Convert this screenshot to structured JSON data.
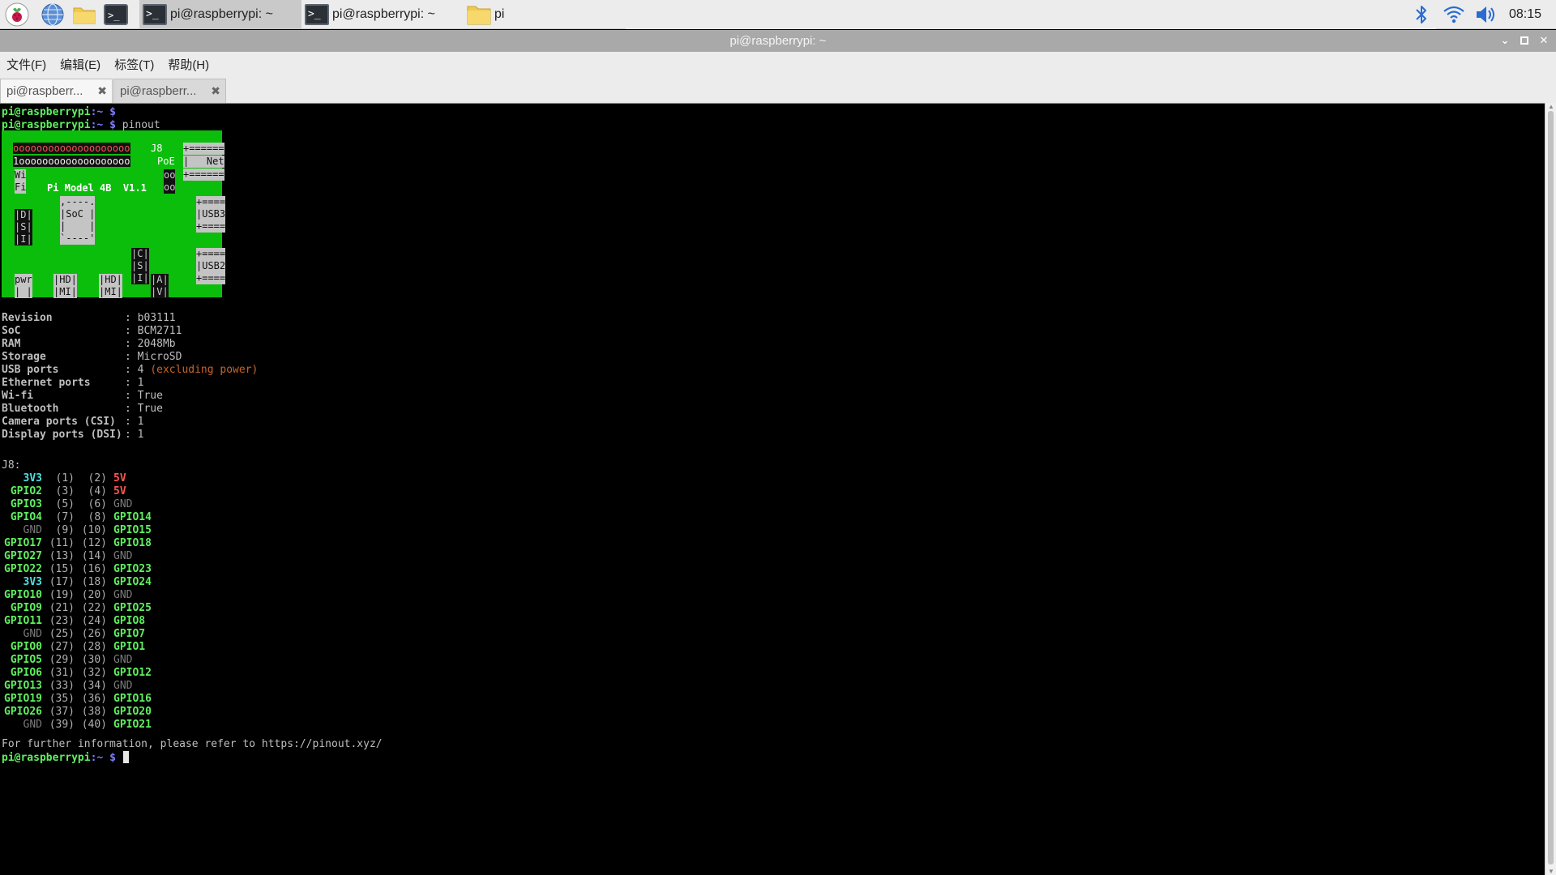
{
  "taskbar": {
    "launchers": [
      "raspberry-menu-icon",
      "web-browser-icon",
      "file-manager-icon",
      "terminal-icon"
    ],
    "tasks": [
      {
        "label": "pi@raspberrypi: ~",
        "icon": "terminal-icon",
        "active": true
      },
      {
        "label": "pi@raspberrypi: ~",
        "icon": "terminal-icon",
        "active": false
      },
      {
        "label": "pi",
        "icon": "folder-icon",
        "active": false
      }
    ],
    "tray": [
      "bluetooth-icon",
      "wifi-icon",
      "volume-icon"
    ],
    "clock": "08:15"
  },
  "window": {
    "title": "pi@raspberrypi: ~",
    "controls": [
      "minimize",
      "maximize",
      "close"
    ]
  },
  "menubar": {
    "items": [
      "文件(F)",
      "编辑(E)",
      "标签(T)",
      "帮助(H)"
    ]
  },
  "tabs": [
    {
      "label": "pi@raspberr...",
      "active": true
    },
    {
      "label": "pi@raspberr...",
      "active": false
    }
  ],
  "terminal": {
    "prompt": "pi@raspberrypi",
    "prompt_suffix": ":~ ",
    "dollar": "$",
    "command": " pinout",
    "board": {
      "header_top": "oooooooooooooooooooo",
      "header_bottom": "1ooooooooooooooooooo",
      "j8": "J8",
      "poe": "PoE",
      "net_top": "+======",
      "net_mid": "|   Net",
      "net_bot": "+======",
      "wifi": "Wi\nFi",
      "model": "Pi Model 4B  V1.1",
      "soc": ",----.\n|SoC |\n|    |\n`----'",
      "dsi": "|D|\n|S|\n|I|",
      "poe_pins": "oo\noo",
      "usb3": "+====\n|USB3\n+====",
      "usb2": "+====\n|USB2\n+====",
      "csi": "|C|\n|S|\n|I|",
      "av": "|A|\n|V|",
      "pwr": "pwr\n| |",
      "hdmi0": "|HD|\n|MI|",
      "hdmi1": "|HD|\n|MI|",
      "dash_top": ",--------------------------------.",
      "dash_bot": "`-| |--------| |----|V|-------'"
    },
    "info": [
      {
        "key": "Revision",
        "value": "b03111",
        "note": ""
      },
      {
        "key": "SoC",
        "value": "BCM2711",
        "note": ""
      },
      {
        "key": "RAM",
        "value": "2048Mb",
        "note": ""
      },
      {
        "key": "Storage",
        "value": "MicroSD",
        "note": ""
      },
      {
        "key": "USB ports",
        "value": "4",
        "note": "(excluding power)"
      },
      {
        "key": "Ethernet ports",
        "value": "1",
        "note": ""
      },
      {
        "key": "Wi-fi",
        "value": "True",
        "note": ""
      },
      {
        "key": "Bluetooth",
        "value": "True",
        "note": ""
      },
      {
        "key": "Camera ports (CSI)",
        "value": "1",
        "note": ""
      },
      {
        "key": "Display ports (DSI)",
        "value": "1",
        "note": ""
      }
    ],
    "j8_label": "J8:",
    "pins": [
      {
        "l": "3V3",
        "a": "(1)",
        "b": "(2)",
        "r": "5V"
      },
      {
        "l": "GPIO2",
        "a": "(3)",
        "b": "(4)",
        "r": "5V"
      },
      {
        "l": "GPIO3",
        "a": "(5)",
        "b": "(6)",
        "r": "GND"
      },
      {
        "l": "GPIO4",
        "a": "(7)",
        "b": "(8)",
        "r": "GPIO14"
      },
      {
        "l": "GND",
        "a": "(9)",
        "b": "(10)",
        "r": "GPIO15"
      },
      {
        "l": "GPIO17",
        "a": "(11)",
        "b": "(12)",
        "r": "GPIO18"
      },
      {
        "l": "GPIO27",
        "a": "(13)",
        "b": "(14)",
        "r": "GND"
      },
      {
        "l": "GPIO22",
        "a": "(15)",
        "b": "(16)",
        "r": "GPIO23"
      },
      {
        "l": "3V3",
        "a": "(17)",
        "b": "(18)",
        "r": "GPIO24"
      },
      {
        "l": "GPIO10",
        "a": "(19)",
        "b": "(20)",
        "r": "GND"
      },
      {
        "l": "GPIO9",
        "a": "(21)",
        "b": "(22)",
        "r": "GPIO25"
      },
      {
        "l": "GPIO11",
        "a": "(23)",
        "b": "(24)",
        "r": "GPIO8"
      },
      {
        "l": "GND",
        "a": "(25)",
        "b": "(26)",
        "r": "GPIO7"
      },
      {
        "l": "GPIO0",
        "a": "(27)",
        "b": "(28)",
        "r": "GPIO1"
      },
      {
        "l": "GPIO5",
        "a": "(29)",
        "b": "(30)",
        "r": "GND"
      },
      {
        "l": "GPIO6",
        "a": "(31)",
        "b": "(32)",
        "r": "GPIO12"
      },
      {
        "l": "GPIO13",
        "a": "(33)",
        "b": "(34)",
        "r": "GND"
      },
      {
        "l": "GPIO19",
        "a": "(35)",
        "b": "(36)",
        "r": "GPIO16"
      },
      {
        "l": "GPIO26",
        "a": "(37)",
        "b": "(38)",
        "r": "GPIO20"
      },
      {
        "l": "GND",
        "a": "(39)",
        "b": "(40)",
        "r": "GPIO21"
      }
    ],
    "footer": "For further information, please refer to https://pinout.xyz/",
    "colors": {
      "background": "#000000",
      "board": "#0cbe0c",
      "gpio": "#5ff05f",
      "v33": "#4ee0e0",
      "v5": "#ff5555",
      "gnd": "#7c7c7c",
      "note": "#c86428"
    }
  }
}
